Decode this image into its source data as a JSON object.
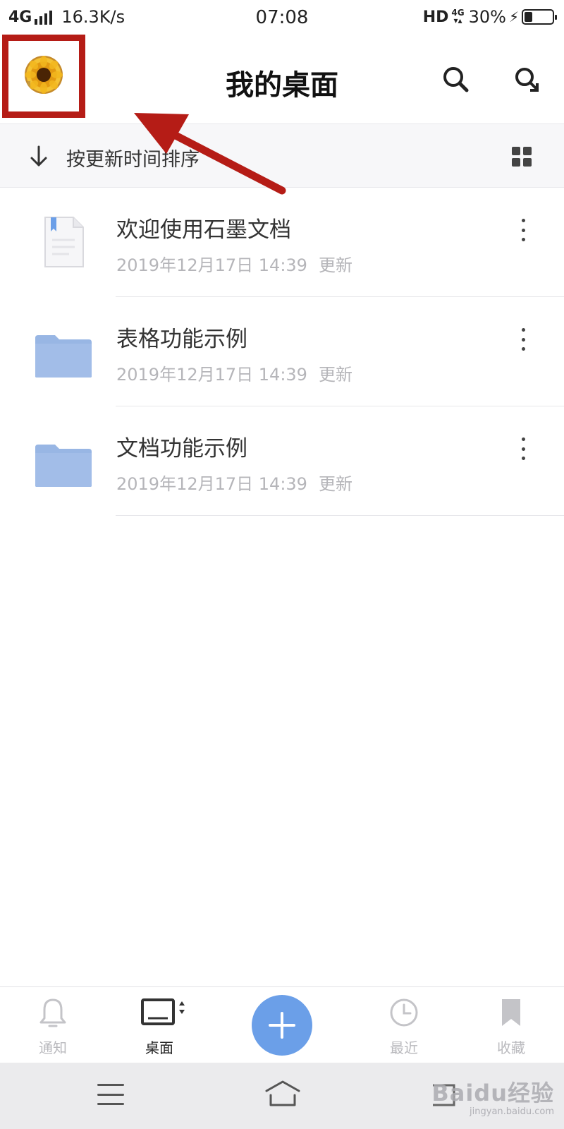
{
  "status_bar": {
    "network": "4G",
    "speed": "16.3K/s",
    "time": "07:08",
    "hd": "HD",
    "network2": "4G",
    "battery_text": "30%",
    "battery_level": 0.3
  },
  "header": {
    "title": "我的桌面",
    "avatar_icon": "sunflower-avatar",
    "search_icon": "search-icon",
    "scan_icon": "search-scan-icon"
  },
  "sort_bar": {
    "label": "按更新时间排序",
    "sort_icon": "arrow-down-icon",
    "view_icon": "grid-view-icon"
  },
  "files": [
    {
      "type": "document",
      "icon": "document-icon",
      "name": "欢迎使用石墨文档",
      "date": "2019年12月17日 14:39",
      "updated": "更新"
    },
    {
      "type": "folder",
      "icon": "folder-icon",
      "name": "表格功能示例",
      "date": "2019年12月17日 14:39",
      "updated": "更新"
    },
    {
      "type": "folder",
      "icon": "folder-icon",
      "name": "文档功能示例",
      "date": "2019年12月17日 14:39",
      "updated": "更新"
    }
  ],
  "bottom_nav": {
    "items": [
      {
        "label": "通知",
        "icon": "bell-icon",
        "active": false
      },
      {
        "label": "桌面",
        "icon": "desktop-icon",
        "active": true
      },
      {
        "label": "最近",
        "icon": "clock-icon",
        "active": false
      },
      {
        "label": "收藏",
        "icon": "bookmark-icon",
        "active": false
      }
    ],
    "fab_icon": "plus-icon"
  },
  "system_nav": {
    "menu_icon": "menu-icon",
    "home_icon": "home-icon",
    "back_icon": "back-icon"
  },
  "watermark": {
    "main": "Baidu经验",
    "sub": "jingyan.baidu.com"
  },
  "colors": {
    "annotation": "#b51c16",
    "fab": "#6b9fe8",
    "folder": "#98b6e4"
  }
}
